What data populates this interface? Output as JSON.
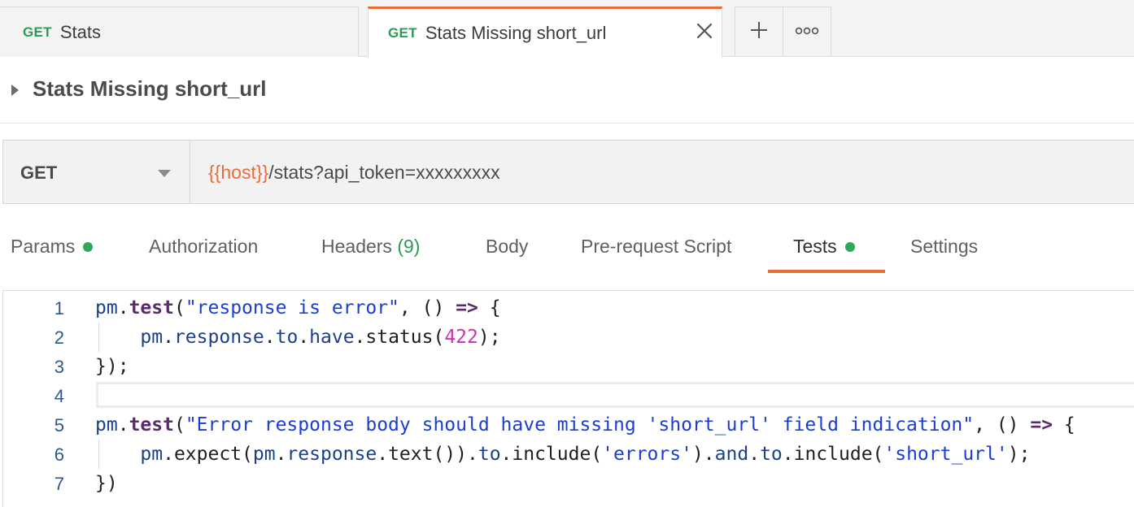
{
  "tabs": [
    {
      "method": "GET",
      "title": "Stats"
    },
    {
      "method": "GET",
      "title": "Stats Missing short_url"
    }
  ],
  "tab_actions": {
    "add_icon": "plus-icon",
    "more_icon": "more-icon"
  },
  "request": {
    "title": "Stats Missing short_url",
    "method": "GET",
    "url_var": "{{host}}",
    "url_rest": "/stats?api_token=xxxxxxxxx"
  },
  "subtabs": [
    {
      "label": "Params",
      "dot": true
    },
    {
      "label": "Authorization"
    },
    {
      "label": "Headers",
      "count": "(9)"
    },
    {
      "label": "Body"
    },
    {
      "label": "Pre-request Script"
    },
    {
      "label": "Tests",
      "dot": true,
      "active": true
    },
    {
      "label": "Settings"
    }
  ],
  "editor": {
    "line_numbers": [
      "1",
      "2",
      "3",
      "4",
      "5",
      "6",
      "7"
    ],
    "lines": [
      [
        {
          "t": "pm",
          "c": "c-obj"
        },
        {
          "t": ".",
          "c": "c-punc"
        },
        {
          "t": "test",
          "c": "c-kw"
        },
        {
          "t": "(",
          "c": "c-punc"
        },
        {
          "t": "\"response is error\"",
          "c": "c-str"
        },
        {
          "t": ", () ",
          "c": "c-punc"
        },
        {
          "t": "=>",
          "c": "c-kw"
        },
        {
          "t": " {",
          "c": "c-punc"
        }
      ],
      [
        {
          "t": "    pm",
          "c": "c-obj"
        },
        {
          "t": ".",
          "c": "c-punc"
        },
        {
          "t": "response",
          "c": "c-obj"
        },
        {
          "t": ".",
          "c": "c-punc"
        },
        {
          "t": "to",
          "c": "c-obj"
        },
        {
          "t": ".",
          "c": "c-punc"
        },
        {
          "t": "have",
          "c": "c-obj"
        },
        {
          "t": ".status(",
          "c": "c-punc"
        },
        {
          "t": "422",
          "c": "c-num"
        },
        {
          "t": ");",
          "c": "c-punc"
        }
      ],
      [
        {
          "t": "});",
          "c": "c-punc"
        }
      ],
      [],
      [
        {
          "t": "pm",
          "c": "c-obj"
        },
        {
          "t": ".",
          "c": "c-punc"
        },
        {
          "t": "test",
          "c": "c-kw"
        },
        {
          "t": "(",
          "c": "c-punc"
        },
        {
          "t": "\"Error response body should have missing 'short_url' field indication\"",
          "c": "c-str"
        },
        {
          "t": ", () ",
          "c": "c-punc"
        },
        {
          "t": "=>",
          "c": "c-kw"
        },
        {
          "t": " {",
          "c": "c-punc"
        }
      ],
      [
        {
          "t": "    pm",
          "c": "c-obj"
        },
        {
          "t": ".expect(",
          "c": "c-punc"
        },
        {
          "t": "pm",
          "c": "c-obj"
        },
        {
          "t": ".",
          "c": "c-punc"
        },
        {
          "t": "response",
          "c": "c-obj"
        },
        {
          "t": ".text()).",
          "c": "c-punc"
        },
        {
          "t": "to",
          "c": "c-obj"
        },
        {
          "t": ".include(",
          "c": "c-punc"
        },
        {
          "t": "'errors'",
          "c": "c-str"
        },
        {
          "t": ").",
          "c": "c-punc"
        },
        {
          "t": "and",
          "c": "c-obj"
        },
        {
          "t": ".",
          "c": "c-punc"
        },
        {
          "t": "to",
          "c": "c-obj"
        },
        {
          "t": ".include(",
          "c": "c-punc"
        },
        {
          "t": "'short_url'",
          "c": "c-str"
        },
        {
          "t": ");",
          "c": "c-punc"
        }
      ],
      [
        {
          "t": "})",
          "c": "c-punc"
        }
      ]
    ]
  },
  "colors": {
    "accent": "#e86c3a",
    "get_method": "#2c9b55",
    "status_dot": "#2fa957"
  }
}
